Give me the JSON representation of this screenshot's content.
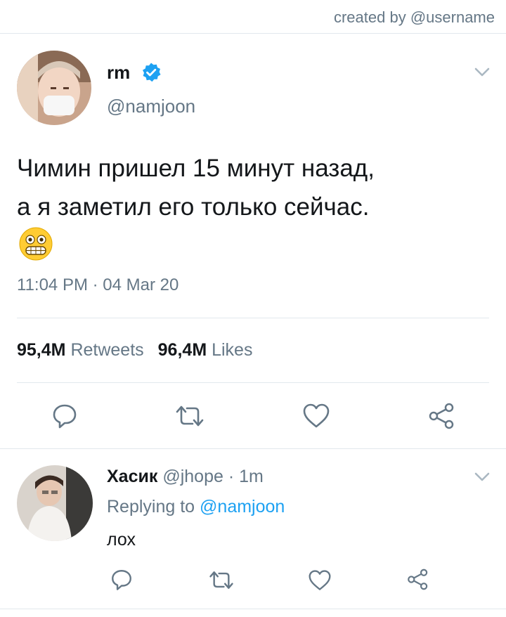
{
  "header": {
    "credit": "created by @username"
  },
  "tweet": {
    "name": "rm",
    "handle": "@namjoon",
    "text_line1": "Чимин пришел 15 минут назад,",
    "text_line2": "а я заметил его только сейчас.",
    "emoji": "grimacing-face",
    "timestamp": "11:04 PM · 04 Mar 20",
    "retweets_count": "95,4M",
    "retweets_label": "Retweets",
    "likes_count": "96,4M",
    "likes_label": "Likes",
    "verified": true
  },
  "reply": {
    "name": "Хасик",
    "handle_time": "@jhope · 1m",
    "replying_prefix": "Replying to",
    "replying_to": "@namjoon",
    "text": "лох"
  },
  "icons": [
    "reply-icon",
    "retweet-icon",
    "like-icon",
    "share-icon",
    "chevron-down-icon",
    "verified-badge-icon"
  ],
  "colors": {
    "accent": "#1da1f2",
    "muted": "#657786",
    "border": "#e1e8ed",
    "text": "#14171a"
  }
}
